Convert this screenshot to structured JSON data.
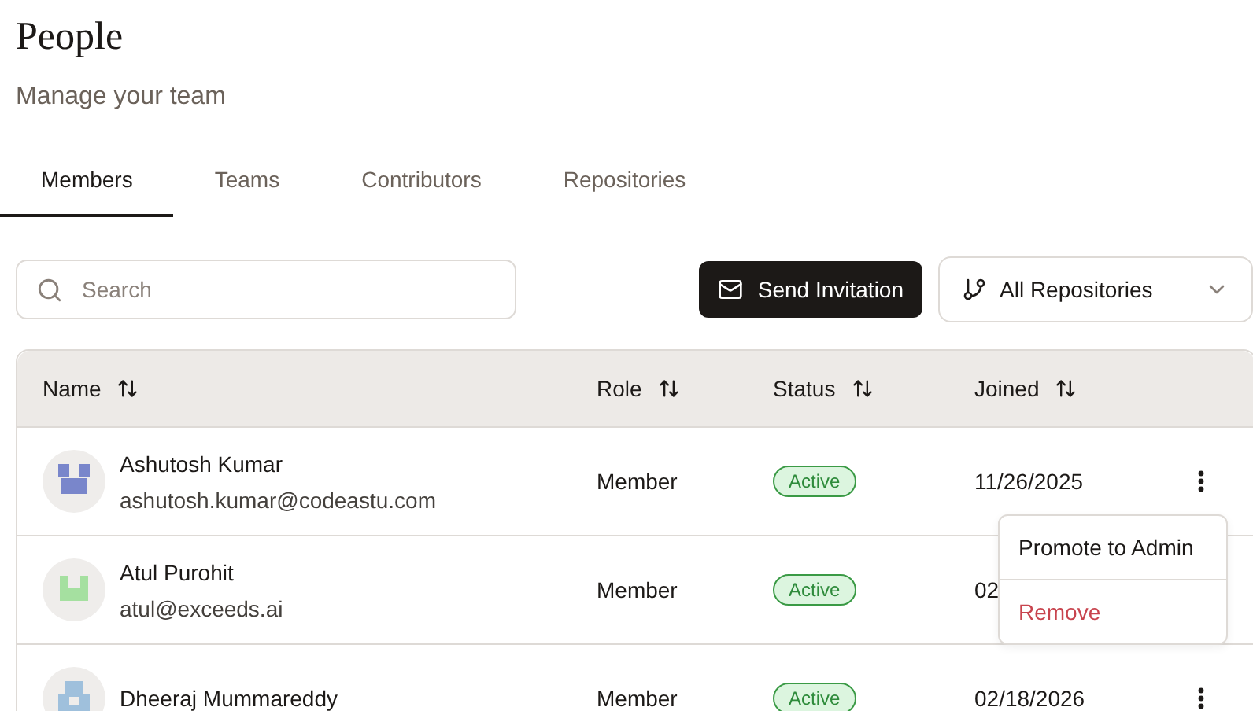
{
  "page": {
    "title": "People",
    "subtitle": "Manage your team"
  },
  "tabs": [
    {
      "label": "Members",
      "selected": true
    },
    {
      "label": "Teams",
      "selected": false
    },
    {
      "label": "Contributors",
      "selected": false
    },
    {
      "label": "Repositories",
      "selected": false
    }
  ],
  "search": {
    "placeholder": "Search"
  },
  "invite_button": {
    "label": "Send Invitation"
  },
  "repository_filter": {
    "value": "All Repositories"
  },
  "table": {
    "columns": [
      "Name",
      "Role",
      "Status",
      "Joined"
    ],
    "rows": [
      {
        "name": "Ashutosh Kumar",
        "email": "ashutosh.kumar@codeastu.com",
        "color": "#7986cb",
        "role": "Member",
        "status": "Active",
        "joined": "11/26/2025",
        "menu_button": true
      },
      {
        "name": "Atul Purohit",
        "email": "atul@exceeds.ai",
        "color": "#a5e0a0",
        "role": "Member",
        "status": "Active",
        "joined": "02",
        "menu_button": false
      },
      {
        "name": "Dheeraj Mummareddy",
        "color": "#9fc0dc",
        "role": "Member",
        "status": "Active",
        "joined": "02/18/2026",
        "menu_button": true
      }
    ]
  },
  "row_menu": {
    "items": [
      {
        "label": "Promote to Admin",
        "kind": "normal"
      },
      {
        "label": "Remove",
        "kind": "danger"
      }
    ]
  }
}
